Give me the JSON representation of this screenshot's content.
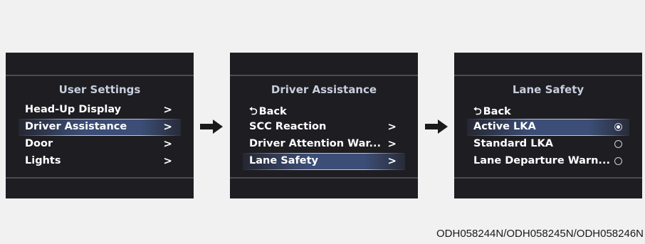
{
  "screens": [
    {
      "title": "User Settings",
      "items": [
        {
          "label": "Head-Up Display",
          "chevron": ">"
        },
        {
          "label": "Driver Assistance",
          "chevron": ">",
          "selected": true
        },
        {
          "label": "Door",
          "chevron": ">"
        },
        {
          "label": "Lights",
          "chevron": ">"
        }
      ]
    },
    {
      "title": "Driver Assistance",
      "back_label": "Back",
      "items": [
        {
          "label": "SCC Reaction",
          "chevron": ">"
        },
        {
          "label": "Driver Attention War...",
          "chevron": ">"
        },
        {
          "label": "Lane Safety",
          "chevron": ">",
          "selected": true
        }
      ]
    },
    {
      "title": "Lane Safety",
      "back_label": "Back",
      "items": [
        {
          "label": "Active LKA",
          "radio": "checked",
          "selected": true
        },
        {
          "label": "Standard LKA",
          "radio": "unchecked"
        },
        {
          "label": "Lane Departure Warn...",
          "radio": "unchecked"
        }
      ]
    }
  ],
  "back_icon": "back-arrow-icon",
  "flow_arrow_icon": "right-arrow-icon",
  "caption": "ODH058244N/ODH058245N/ODH058246N",
  "colors": {
    "screen_bg": "#1e1d22",
    "title_text": "#c7cedd",
    "item_text": "#ffffff",
    "highlight": "#3c4e77",
    "page_bg": "#f1f1f2"
  }
}
